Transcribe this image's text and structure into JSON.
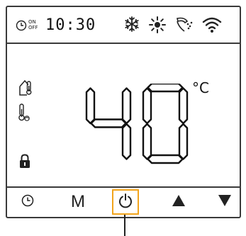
{
  "status_bar": {
    "timer_on_label": "ON",
    "timer_off_label": "OFF",
    "time": "10:30",
    "icons": [
      "clock-icon",
      "snowflake-icon",
      "sun-icon",
      "water-flow-icon",
      "wifi-icon"
    ]
  },
  "indicators": {
    "icons": [
      "house-temperature-icon",
      "water-temperature-icon",
      "lock-icon"
    ]
  },
  "display": {
    "temperature": "40",
    "unit": "°C"
  },
  "controls": {
    "buttons": [
      {
        "name": "timer-button",
        "icon": "clock-icon"
      },
      {
        "name": "mode-button",
        "label": "M"
      },
      {
        "name": "power-button",
        "icon": "power-icon",
        "highlighted": true
      },
      {
        "name": "up-button",
        "icon": "triangle-up-icon"
      },
      {
        "name": "down-button",
        "icon": "triangle-down-icon"
      }
    ],
    "mode_label": "M"
  },
  "colors": {
    "highlight": "#f2a41c",
    "foreground": "#111111",
    "border": "#3a3a3a"
  }
}
